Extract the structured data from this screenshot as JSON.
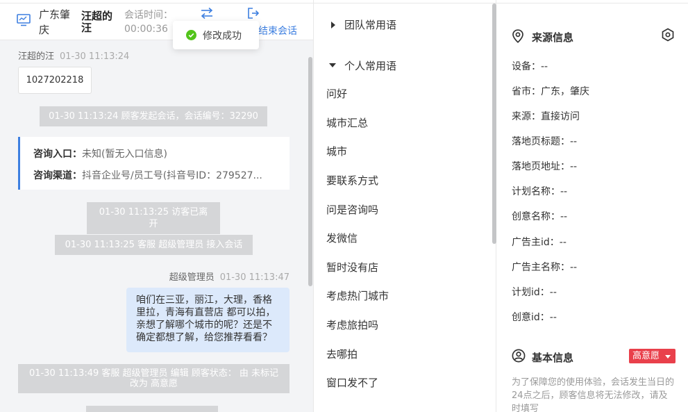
{
  "header": {
    "location": "广东肇庆",
    "visitor_name": "汪超的汪",
    "time_label": "会话时间：",
    "time_value": "00:00:36",
    "end_label": "结束会话"
  },
  "toast": {
    "text": "修改成功"
  },
  "chat": {
    "first_meta": {
      "name": "汪超的汪",
      "time": "01-30 11:13:24"
    },
    "phone_number": "1027202218",
    "sys_start": "01-30 11:13:24 顾客发起会话，会话编号：32290",
    "info_card": {
      "entry_label": "咨询入口：",
      "entry_value": "未知(暂无入口信息)",
      "channel_label": "咨询渠道：",
      "channel_value": "抖音企业号/员工号(抖音号ID：279527..."
    },
    "sys_left": "01-30 11:13:25 访客已离开",
    "sys_join": "01-30 11:13:25 客服 超级管理员 接入会话",
    "agent_meta": {
      "name": "超级管理员",
      "time": "01-30 11:13:47"
    },
    "agent_message": "咱们在三亚，丽江，大理，香格里拉，青海有直营店 都可以拍，亲想了解哪个城市的呢？还是不确定都想了解，给您推荐看看？",
    "sys_edit": "01-30 11:13:49 客服 超级管理员 编辑 顾客状态： 由 未标记 改为 高意愿"
  },
  "phrases": {
    "team_group": "团队常用语",
    "personal_group": "个人常用语",
    "items": [
      "问好",
      "城市汇总",
      "城市",
      "要联系方式",
      "问是咨询吗",
      "发微信",
      "暂时没有店",
      "考虑热门城市",
      "考虑旅拍吗",
      "去哪拍",
      "窗口发不了"
    ]
  },
  "source_info": {
    "title": "来源信息",
    "rows": [
      "设备：--",
      "省市：广东，肇庆",
      "来源：直接访问",
      "落地页标题：--",
      "落地页地址：--",
      "计划名称：--",
      "创意名称：--",
      "广告主id：--",
      "广告主名称：--",
      "计划id：--",
      "创意id：--"
    ]
  },
  "basic_info": {
    "title": "基本信息",
    "status_badge": "高意愿",
    "note": "为了保障您的使用体验，会话发生当日的24点之后，顾客信息将无法修改，请及时填写"
  },
  "colors": {
    "accent": "#3d7fe0",
    "badge_red": "#e9404b",
    "agent_bubble": "#dce9fb",
    "system_message": "#d5d6d8",
    "success_green": "#52c41a"
  }
}
